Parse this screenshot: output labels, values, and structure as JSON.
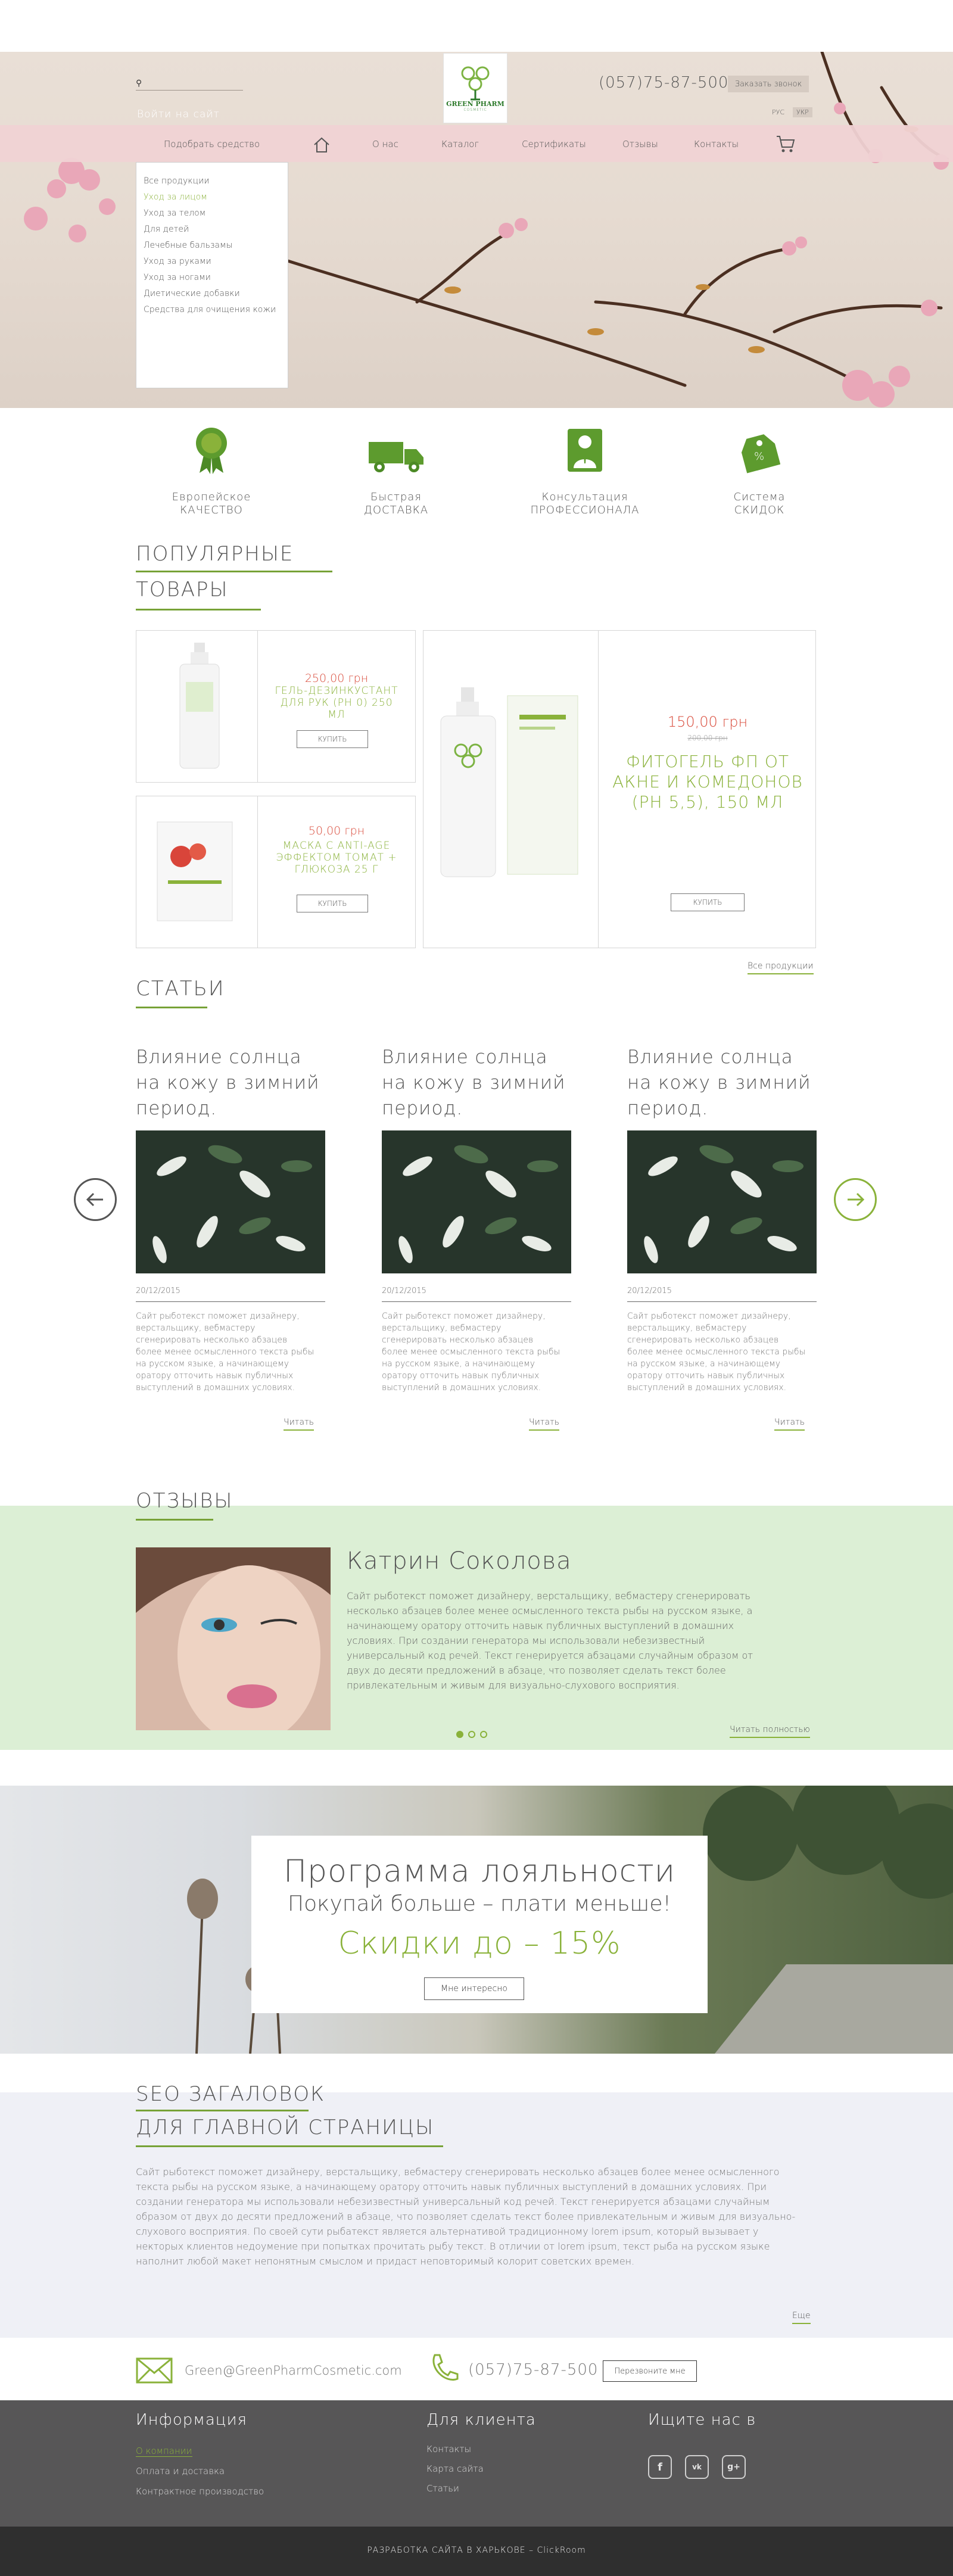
{
  "header": {
    "logo_text": "GREEN PHARM",
    "logo_sub": "COSMETIC",
    "login": "Войти на сайт",
    "phone": "(057)75-87-500",
    "order_call": "Заказать звонок",
    "langs": [
      "РУС",
      "УКР"
    ]
  },
  "nav": {
    "pick_remedy": "Подобрать средство",
    "about": "О нас",
    "catalog": "Каталог",
    "certificates": "Сертификаты",
    "reviews": "Отзывы",
    "contacts": "Контакты"
  },
  "dropdown": [
    "Все продукции",
    "Уход за лицом",
    "Уход за телом",
    "Для детей",
    "Лечебные бальзамы",
    "Уход за руками",
    "Уход за ногами",
    "Диетические добавки",
    "Средства для очищения кожи"
  ],
  "features": [
    {
      "line1": "Европейское",
      "line2": "КАЧЕСТВО",
      "icon": "award-ribbon-icon"
    },
    {
      "line1": "Быстрая",
      "line2": "ДОСТАВКА",
      "icon": "truck-icon"
    },
    {
      "line1": "Консультация",
      "line2": "ПРОФЕССИОНАЛА",
      "icon": "consultant-icon"
    },
    {
      "line1": "Система",
      "line2": "СКИДОК",
      "icon": "discount-tag-icon"
    }
  ],
  "popular": {
    "title1": "ПОПУЛЯРНЫЕ",
    "title2": "ТОВАРЫ",
    "all_products": "Все продукции",
    "products": [
      {
        "price": "250,00 грн",
        "name": "ГЕЛЬ-ДЕЗИНКУСТАНТ ДЛЯ РУК (PH 0) 250 МЛ",
        "buy": "КУПИТЬ"
      },
      {
        "price": "50,00 грн",
        "name": "МАСКА С ANTI-AGE ЭФФЕКТОМ ТОМАТ + ГЛЮКОЗА 25 Г",
        "buy": "КУПИТЬ"
      },
      {
        "price": "150,00 грн",
        "old_price": "200,00 грн",
        "name": "ФИТОГЕЛЬ ФП ОТ АКНЕ И КОМЕДОНОВ (PH 5,5), 150 МЛ",
        "buy": "КУПИТЬ"
      }
    ]
  },
  "articles": {
    "title": "СТАТЬИ",
    "items": [
      {
        "title": "Влияние солнца на кожу в зимний период.",
        "date": "20/12/2015",
        "text": "Сайт рыботекст поможет дизайнеру, верстальщику, вебмастеру сгенерировать несколько абзацев более менее осмысленного текста рыбы на русском языке, а начинающему оратору отточить навык публичных выступлений в домашних условиях.",
        "read": "Читать"
      },
      {
        "title": "Влияние солнца на кожу в зимний период.",
        "date": "20/12/2015",
        "text": "Сайт рыботекст поможет дизайнеру, верстальщику, вебмастеру сгенерировать несколько абзацев более менее осмысленного текста рыбы на русском языке, а начинающему оратору отточить навык публичных выступлений в домашних условиях.",
        "read": "Читать"
      },
      {
        "title": "Влияние солнца на кожу в зимний период.",
        "date": "20/12/2015",
        "text": "Сайт рыботекст поможет дизайнеру, верстальщику, вебмастеру сгенерировать несколько абзацев более менее осмысленного текста рыбы на русском языке, а начинающему оратору отточить навык публичных выступлений в домашних условиях.",
        "read": "Читать"
      }
    ]
  },
  "reviews": {
    "title": "ОТЗЫВЫ",
    "name": "Катрин Соколова",
    "text": "Сайт рыботекст поможет дизайнеру, верстальщику, вебмастеру сгенерировать несколько абзацев более менее осмысленного текста рыбы на русском языке, а начинающему оратору отточить навык публичных выступлений в домашних условиях. При создании генератора мы использовали небезизвестный универсальный код речей. Текст генерируется абзацами случайным образом от двух до десяти предложений в абзаце, что позволяет сделать текст более привлекательным и живым для визуально-слухового восприятия.",
    "read_more": "Читать полностью"
  },
  "loyalty": {
    "title": "Программа лояльности",
    "subtitle": "Покупай больше – плати меньше!",
    "discount": "Скидки до – 15%",
    "button": "Мне интересно"
  },
  "seo": {
    "title1": "SEO ЗАГАЛОВОК",
    "title2": "ДЛЯ ГЛАВНОЙ СТРАНИЦЫ",
    "text": "Сайт рыботекст поможет дизайнеру, верстальщику, вебмастеру сгенерировать несколько абзацев более менее осмысленного текста рыбы на русском языке, а начинающему оратору отточить навык публичных выступлений в домашних условиях. При создании генератора мы использовали небезизвестный универсальный код речей. Текст генерируется абзацами случайным образом от двух до десяти предложений в абзаце, что позволяет сделать текст более привлекательным и живым для визуально-слухового восприятия. По своей сути рыбатекст является альтернативой традиционному lorem ipsum, который вызывает у некторых клиентов недоумение при попытках прочитать рыбу текст. В отличии от lorem ipsum, текст рыба на русском языке наполнит любой макет непонятным смыслом и придаст неповторимый колорит советских времен.",
    "more": "Еще"
  },
  "contact": {
    "email": "Green@GreenPharmCosmetic.com",
    "phone": "(057)75-87-500",
    "button": "Перезвоните мне"
  },
  "footer": {
    "info_title": "Информация",
    "info_links": [
      "О компании",
      "Оплата и доставка",
      "Контрактное производство"
    ],
    "client_title": "Для клиента",
    "client_links": [
      "Контакты",
      "Карта сайта",
      "Статьи"
    ],
    "social_title": "Ищите нас в",
    "copyright": "РАЗРАБОТКА САЙТА В ХАРЬКОВЕ – ClickRoom"
  },
  "colors": {
    "accent_green": "#8ab23a",
    "price_red": "#d94b3b",
    "nav_pink": "#f0d2d4",
    "reviews_bg": "#dcefd5",
    "footer_bg": "#575657"
  }
}
